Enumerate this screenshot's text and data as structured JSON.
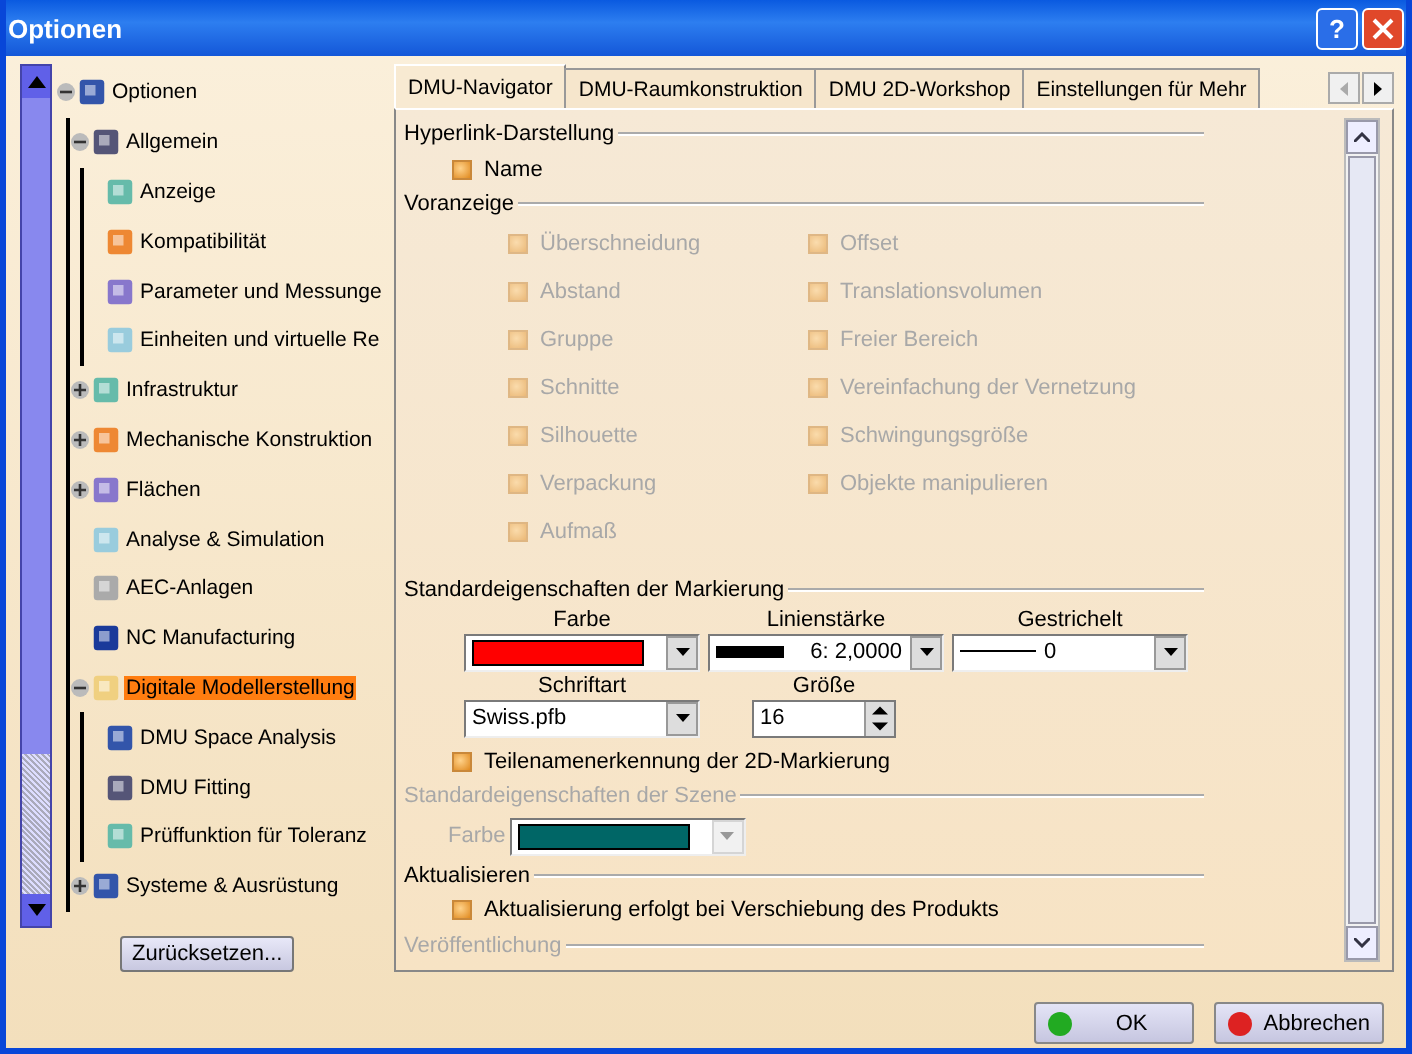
{
  "window": {
    "title": "Optionen",
    "help_button": "?"
  },
  "tree": [
    {
      "label": "Optionen",
      "expanded": true,
      "selected": false,
      "children": [
        {
          "label": "Allgemein",
          "expanded": true,
          "selected": false,
          "children": [
            {
              "label": "Anzeige",
              "selected": false
            },
            {
              "label": "Kompatibilität",
              "selected": false
            },
            {
              "label": "Parameter und Messunge",
              "selected": false
            },
            {
              "label": "Einheiten und virtuelle Re",
              "selected": false
            }
          ]
        },
        {
          "label": "Infrastruktur",
          "expanded": false,
          "selected": false
        },
        {
          "label": "Mechanische Konstruktion",
          "expanded": false,
          "selected": false
        },
        {
          "label": "Flächen",
          "expanded": false,
          "selected": false
        },
        {
          "label": "Analyse & Simulation",
          "selected": false
        },
        {
          "label": "AEC-Anlagen",
          "selected": false
        },
        {
          "label": "NC Manufacturing",
          "selected": false
        },
        {
          "label": "Digitale Modellerstellung",
          "expanded": true,
          "selected": true,
          "children": [
            {
              "label": "DMU Space Analysis",
              "selected": false
            },
            {
              "label": "DMU Fitting",
              "selected": false
            },
            {
              "label": "Prüffunktion für Toleranz",
              "selected": false
            }
          ]
        },
        {
          "label": "Systeme & Ausrüstung",
          "expanded": false,
          "selected": false
        }
      ]
    }
  ],
  "reset_button": "Zurücksetzen...",
  "tabs": [
    {
      "label": "DMU-Navigator",
      "selected": true
    },
    {
      "label": "DMU-Raumkonstruktion",
      "selected": false
    },
    {
      "label": "DMU 2D-Workshop",
      "selected": false
    },
    {
      "label": "Einstellungen für Mehr",
      "selected": false
    }
  ],
  "hyperlink": {
    "title": "Hyperlink-Darstellung",
    "disabled": false,
    "options": [
      {
        "label": "Name",
        "checked": true,
        "disabled": false
      }
    ]
  },
  "preview": {
    "title": "Voranzeige",
    "disabled": false,
    "options": [
      {
        "label": "Überschneidung",
        "checked": true,
        "disabled": true
      },
      {
        "label": "Abstand",
        "checked": true,
        "disabled": true
      },
      {
        "label": "Gruppe",
        "checked": true,
        "disabled": true
      },
      {
        "label": "Schnitte",
        "checked": true,
        "disabled": true
      },
      {
        "label": "Silhouette",
        "checked": true,
        "disabled": true
      },
      {
        "label": "Verpackung",
        "checked": true,
        "disabled": true
      },
      {
        "label": "Aufmaß",
        "checked": true,
        "disabled": true
      },
      {
        "label": "Offset",
        "checked": true,
        "disabled": true
      },
      {
        "label": "Translationsvolumen",
        "checked": true,
        "disabled": true
      },
      {
        "label": "Freier Bereich",
        "checked": true,
        "disabled": true
      },
      {
        "label": "Vereinfachung der Vernetzung",
        "checked": true,
        "disabled": true
      },
      {
        "label": "Schwingungsgröße",
        "checked": true,
        "disabled": true
      },
      {
        "label": "Objekte manipulieren",
        "checked": true,
        "disabled": true
      }
    ]
  },
  "markup": {
    "title": "Standardeigenschaften der Markierung",
    "disabled": false,
    "color": {
      "label": "Farbe",
      "color": "#ff0000"
    },
    "line_width": {
      "label": "Linienstärke",
      "value": "6: 2,0000"
    },
    "dash": {
      "label": "Gestrichelt",
      "value": "0"
    },
    "font": {
      "label": "Schriftart",
      "value": "Swiss.pfb"
    },
    "size": {
      "label": "Größe",
      "value": "16"
    },
    "options": [
      {
        "label": "Teilenamenerkennung der 2D-Markierung",
        "checked": true,
        "disabled": false
      }
    ]
  },
  "scene": {
    "title": "Standardeigenschaften der Szene",
    "disabled": true,
    "color": {
      "label": "Farbe",
      "color": "#006666"
    }
  },
  "update": {
    "title": "Aktualisieren",
    "disabled": false,
    "options": [
      {
        "label": "Aktualisierung erfolgt bei Verschiebung des Produkts",
        "checked": true,
        "disabled": false
      }
    ]
  },
  "publication": {
    "title": "Veröffentlichung",
    "disabled": true
  },
  "buttons": [
    {
      "label": "OK",
      "kind": "ok"
    },
    {
      "label": "Abbrechen",
      "kind": "cancel"
    }
  ]
}
